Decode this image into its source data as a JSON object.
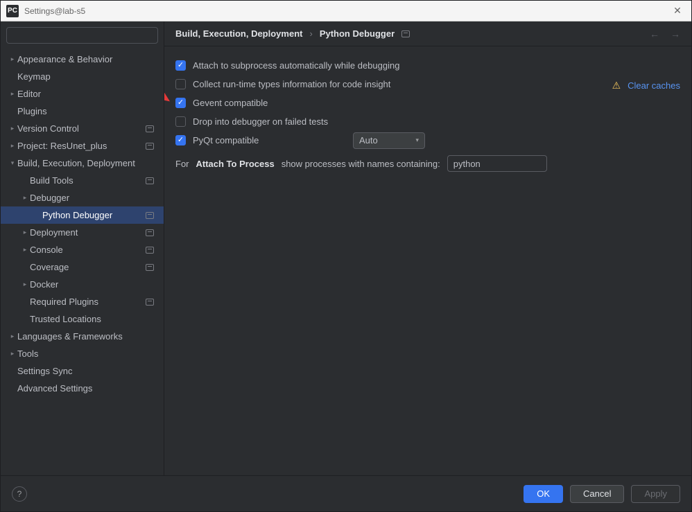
{
  "window": {
    "title": "Settings@lab-s5",
    "app_abbrev": "PC"
  },
  "search": {
    "placeholder": ""
  },
  "tree": [
    {
      "label": "Appearance & Behavior",
      "indent": 0,
      "chev": "right",
      "proj": false
    },
    {
      "label": "Keymap",
      "indent": 0,
      "chev": "",
      "proj": false
    },
    {
      "label": "Editor",
      "indent": 0,
      "chev": "right",
      "proj": false
    },
    {
      "label": "Plugins",
      "indent": 0,
      "chev": "",
      "proj": false
    },
    {
      "label": "Version Control",
      "indent": 0,
      "chev": "right",
      "proj": true
    },
    {
      "label": "Project: ResUnet_plus",
      "indent": 0,
      "chev": "right",
      "proj": true
    },
    {
      "label": "Build, Execution, Deployment",
      "indent": 0,
      "chev": "down",
      "proj": false
    },
    {
      "label": "Build Tools",
      "indent": 1,
      "chev": "",
      "proj": true
    },
    {
      "label": "Debugger",
      "indent": 1,
      "chev": "right",
      "proj": false
    },
    {
      "label": "Python Debugger",
      "indent": 2,
      "chev": "",
      "proj": true,
      "selected": true
    },
    {
      "label": "Deployment",
      "indent": 1,
      "chev": "right",
      "proj": true
    },
    {
      "label": "Console",
      "indent": 1,
      "chev": "right",
      "proj": true
    },
    {
      "label": "Coverage",
      "indent": 1,
      "chev": "",
      "proj": true
    },
    {
      "label": "Docker",
      "indent": 1,
      "chev": "right",
      "proj": false
    },
    {
      "label": "Required Plugins",
      "indent": 1,
      "chev": "",
      "proj": true
    },
    {
      "label": "Trusted Locations",
      "indent": 1,
      "chev": "",
      "proj": false
    },
    {
      "label": "Languages & Frameworks",
      "indent": 0,
      "chev": "right",
      "proj": false
    },
    {
      "label": "Tools",
      "indent": 0,
      "chev": "right",
      "proj": false
    },
    {
      "label": "Settings Sync",
      "indent": 0,
      "chev": "",
      "proj": false
    },
    {
      "label": "Advanced Settings",
      "indent": 0,
      "chev": "",
      "proj": false
    }
  ],
  "breadcrumb": {
    "root": "Build, Execution, Deployment",
    "leaf": "Python Debugger"
  },
  "options": {
    "attach_subprocess": {
      "label": "Attach to subprocess automatically while debugging",
      "checked": true
    },
    "collect_runtime": {
      "label": "Collect run-time types information for code insight",
      "checked": false
    },
    "gevent": {
      "label": "Gevent compatible",
      "checked": true
    },
    "drop_into": {
      "label": "Drop into debugger on failed tests",
      "checked": false
    },
    "pyqt": {
      "label": "PyQt compatible",
      "checked": true,
      "select_value": "Auto"
    }
  },
  "clear_caches": {
    "label": "Clear caches"
  },
  "attach_process": {
    "pre": "For",
    "bold": "Attach To Process",
    "post": "show processes with names containing:",
    "value": "python"
  },
  "buttons": {
    "ok": "OK",
    "cancel": "Cancel",
    "apply": "Apply",
    "help": "?"
  }
}
